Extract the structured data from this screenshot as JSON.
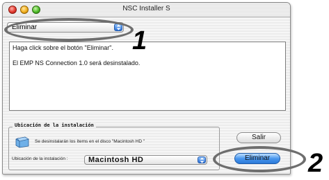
{
  "window": {
    "title": "NSC Installer S"
  },
  "action_popup": {
    "selected": "Eliminar"
  },
  "info_text": {
    "line1": "Haga click sobre el botón \"Eliminar\".",
    "line2": "El EMP NS Connection 1.0 será desinstalado."
  },
  "install_location": {
    "group_title": "Ubicación de la instalación",
    "disk_message": "Se desinstalarán los ítems en el disco \"Macintosh HD \"",
    "location_label": "Ubicación de la instalación :",
    "location_value": "Macintosh HD"
  },
  "buttons": {
    "quit_label": "Salir",
    "remove_label": "Eliminar"
  },
  "annotations": {
    "step1": "1",
    "step2": "2"
  },
  "icons": {
    "disk": "hard-disk-icon",
    "popup_arrows": "up-down-arrows-icon"
  }
}
